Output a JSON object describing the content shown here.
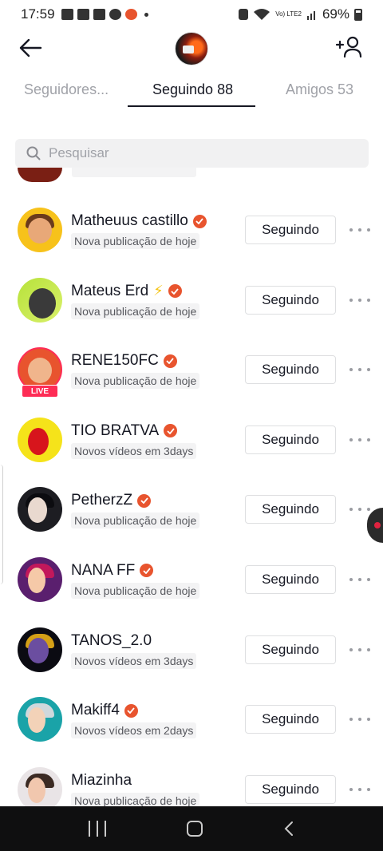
{
  "status_bar": {
    "time": "17:59",
    "battery": "69%",
    "network": "Vo) LTE2"
  },
  "header": {
    "back_label": "Voltar",
    "add_friend_label": "Adicionar amigos"
  },
  "tabs": [
    {
      "label": "Seguidores...",
      "active": false
    },
    {
      "label": "Seguindo 88",
      "active": true
    },
    {
      "label": "Amigos 53",
      "active": false
    }
  ],
  "search": {
    "placeholder": "Pesquisar",
    "value": ""
  },
  "follow_button_label": "Seguindo",
  "accent_color": "#e8542e",
  "users": [
    {
      "name": "Matheuus castillo",
      "subtitle": "Nova publicação de hoje",
      "verified": true
    },
    {
      "name": "Mateus Erd",
      "subtitle": "Nova publicação de hoje",
      "verified": true,
      "emoji": "⚡"
    },
    {
      "name": "RENE150FC",
      "subtitle": "Nova publicação de hoje",
      "verified": true,
      "live": "LIVE"
    },
    {
      "name": "TIO BRATVA",
      "subtitle": "Novos vídeos em 3days",
      "verified": true
    },
    {
      "name": "PetherzZ",
      "subtitle": "Nova publicação de hoje",
      "verified": true
    },
    {
      "name": "NANA FF",
      "subtitle": "Nova publicação de hoje",
      "verified": true
    },
    {
      "name": "TANOS_2.0",
      "subtitle": "Novos vídeos em 3days",
      "verified": false
    },
    {
      "name": "Makiff4",
      "subtitle": "Novos vídeos em 2days",
      "verified": true
    },
    {
      "name": "Miazinha",
      "subtitle": "Nova publicação de hoje",
      "verified": false
    }
  ]
}
